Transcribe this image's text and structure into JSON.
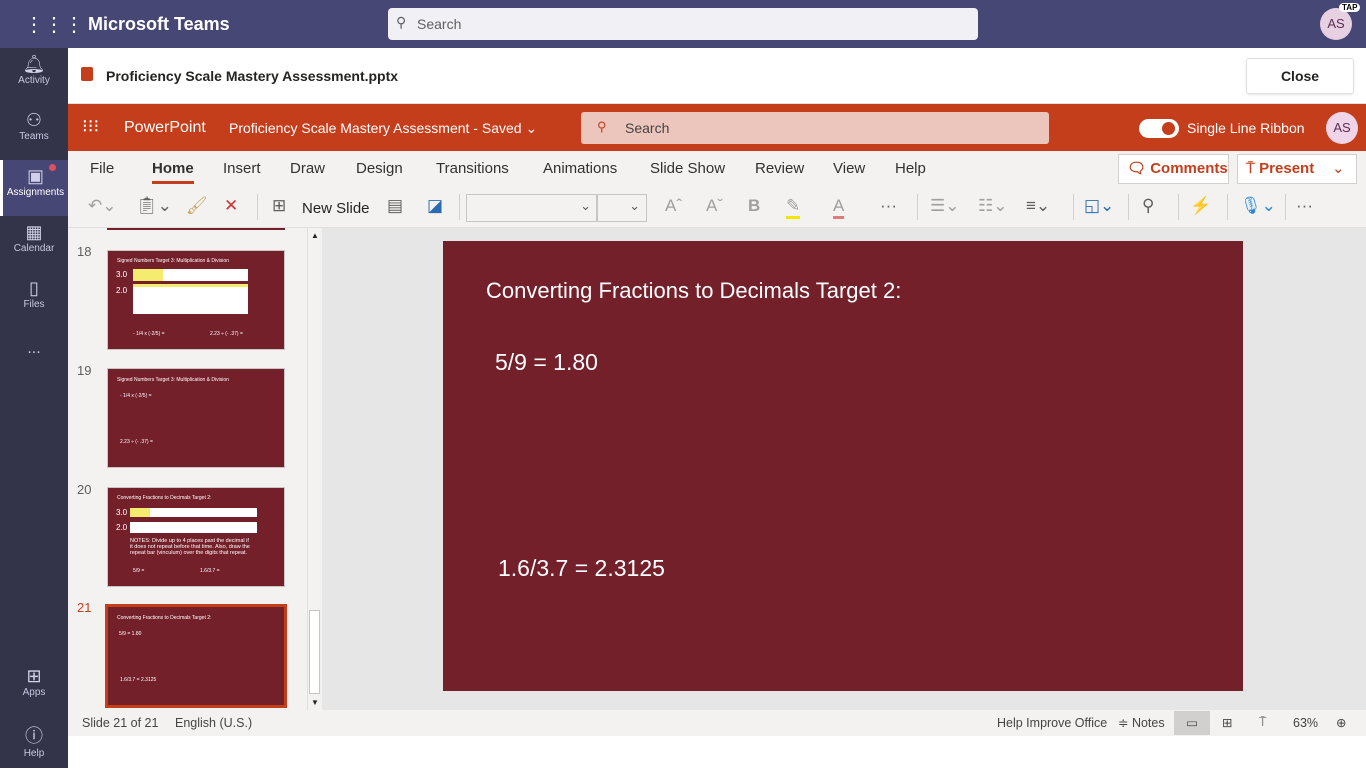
{
  "teams": {
    "app_title": "Microsoft Teams",
    "search_placeholder": "Search",
    "avatar": "AS",
    "avatar_badge": "TAP",
    "rail": [
      {
        "label": "Activity",
        "icon": "bell-icon"
      },
      {
        "label": "Teams",
        "icon": "teams-icon"
      },
      {
        "label": "Assignments",
        "icon": "assignments-icon"
      },
      {
        "label": "Calendar",
        "icon": "calendar-icon"
      },
      {
        "label": "Files",
        "icon": "files-icon"
      },
      {
        "label": "...",
        "icon": "more-icon"
      },
      {
        "label": "Apps",
        "icon": "apps-icon"
      },
      {
        "label": "Help",
        "icon": "help-icon"
      }
    ]
  },
  "file": {
    "name": "Proficiency Scale Mastery Assessment.pptx",
    "close": "Close"
  },
  "ppt": {
    "app": "PowerPoint",
    "doc_title": "Proficiency Scale Mastery Assessment",
    "saved": "Saved",
    "search_placeholder": "Search",
    "single_line_ribbon": "Single Line Ribbon",
    "avatar": "AS"
  },
  "tabs": [
    "File",
    "Home",
    "Insert",
    "Draw",
    "Design",
    "Transitions",
    "Animations",
    "Slide Show",
    "Review",
    "View",
    "Help"
  ],
  "active_tab": "Home",
  "buttons": {
    "comments": "Comments",
    "present": "Present",
    "new_slide": "New Slide"
  },
  "thumbs": [
    {
      "num": "18",
      "title": "Signed Numbers Target 3:  Multiplication & Division",
      "l1": "3.0",
      "l2": "2.0",
      "a": "- 1/4 x (-2/5) =",
      "b": "2.23 ÷ (- .37) ="
    },
    {
      "num": "19",
      "title": "Signed Numbers Target 3:  Multiplication & Division",
      "a": "- 1/4 x (-2/5) =",
      "b": "2.23 ÷ (- .37) ="
    },
    {
      "num": "20",
      "title": "Converting Fractions to Decimals Target 2:",
      "l1": "3.0",
      "l2": "2.0",
      "notes": "NOTES: Divide up to 4 places past the decimal if it does not repeat before that time.  Also, draw the repeat bar (vinculum) over the digits that repeat.",
      "a": "5/9 =",
      "b": "1.6/3.7 ="
    },
    {
      "num": "21",
      "title": "Converting Fractions to Decimals Target 2:",
      "a": "5/9 = 1.80",
      "b": "1.6/3.7  = 2.3125"
    }
  ],
  "slide": {
    "title": "Converting Fractions to Decimals Target 2:",
    "eq1": "5/9 = 1.80",
    "eq2": "1.6/3.7  = 2.3125"
  },
  "status": {
    "slide": "Slide 21 of 21",
    "lang": "English (U.S.)",
    "help": "Help Improve Office",
    "notes": "Notes",
    "zoom": "63%"
  }
}
